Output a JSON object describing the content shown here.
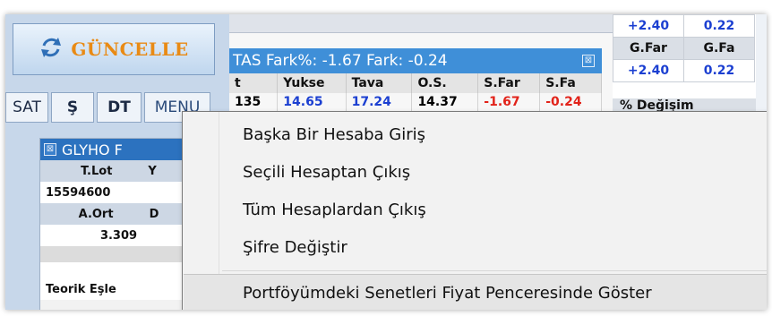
{
  "toolbar": {
    "refresh_label": "GÜNCELLE",
    "tabs": [
      "SAT",
      "Ş",
      "DT",
      "MENU"
    ]
  },
  "mini_panel": {
    "title": "GLYHO F",
    "head1": "T.Lot",
    "head1b": "Y",
    "val1": "15594600",
    "head2": "A.Ort",
    "head2b": "D",
    "val2": "3.309",
    "footer": "Teorik Eşle"
  },
  "center": {
    "title": "TAS Fark%: -1.67  Fark: -0.24",
    "columns": [
      "t",
      "Yukse",
      "Tava",
      "O.S.",
      "S.Far",
      "S.Fa"
    ],
    "row": [
      "135",
      "14.65",
      "17.24",
      "14.37",
      "-1.67",
      "-0.24"
    ]
  },
  "right": {
    "top_values": [
      "+2.40",
      "0.22"
    ],
    "headers": [
      "G.Far",
      "G.Fa"
    ],
    "values": [
      "+2.40",
      "0.22"
    ],
    "degisim": "% Değişim"
  },
  "context_menu": {
    "items": [
      "Başka Bir Hesaba Giriş",
      "Seçili Hesaptan Çıkış",
      "Tüm Hesaplardan Çıkış",
      "Şifre Değiştir",
      "Portföyümdeki Senetleri Fiyat Penceresinde Göster"
    ]
  },
  "colors": {
    "accent": "#3f8fd8",
    "refresh_text": "#e98a14",
    "positive": "#1b3fd1",
    "negative": "#e2231a"
  }
}
